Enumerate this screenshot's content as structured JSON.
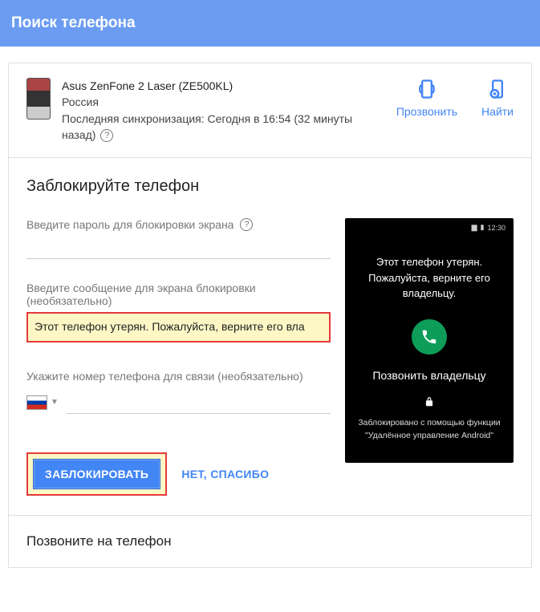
{
  "header": {
    "title": "Поиск телефона"
  },
  "device": {
    "name": "Asus ZenFone 2 Laser (ZE500KL)",
    "location": "Россия",
    "sync": "Последняя синхронизация: Сегодня в 16:54 (32 минуты назад)"
  },
  "actions": {
    "ring": "Прозвонить",
    "find": "Найти"
  },
  "lock": {
    "title": "Заблокируйте телефон",
    "password_label": "Введите пароль для блокировки экрана",
    "message_label": "Введите сообщение для экрана блокировки (необязательно)",
    "message_value": "Этот телефон утерян. Пожалуйста, верните его вла",
    "phone_label": "Укажите номер телефона для связи (необязательно)",
    "lock_button": "ЗАБЛОКИРОВАТЬ",
    "skip_button": "НЕТ, СПАСИБО"
  },
  "preview": {
    "time": "12:30",
    "message": "Этот телефон утерян. Пожалуйста, верните его владельцу.",
    "call_owner": "Позвонить владельцу",
    "locked_via": "Заблокировано с помощью функции",
    "service": "\"Удалённое управление Android\""
  },
  "ring_section": {
    "title": "Позвоните на телефон"
  }
}
